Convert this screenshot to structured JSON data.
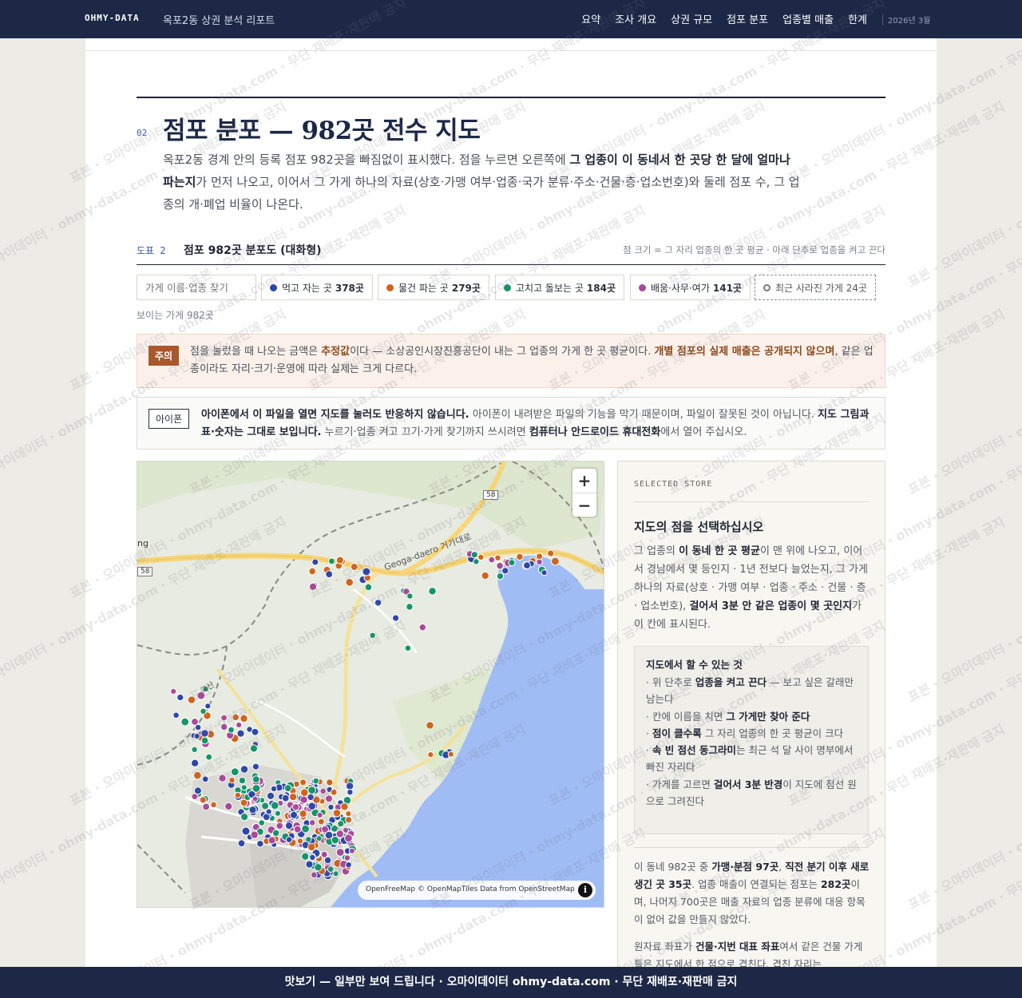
{
  "nav": {
    "brand": "OHMY-DATA",
    "report_title": "옥포2동 상권 분석 리포트",
    "links": [
      "요약",
      "조사 개요",
      "상권 규모",
      "점포 분포",
      "업종별 매출",
      "한계"
    ],
    "date": "2026년 3월"
  },
  "section": {
    "number": "02",
    "title": "점포 분포 — 982곳 전수 지도",
    "lead_1": "옥포2동 경계 안의 등록 점포 982곳을 빠짐없이 표시했다. 점을 누르면 오른쪽에 ",
    "lead_bold": "그 업종이 이 동네서 한 곳당 한 달에 얼마나 파는지",
    "lead_2": "가 먼저 나오고, 이어서 그 가게 하나의 자료(상호·가맹 여부·업종·국가 분류·주소·건물·층·업소번호)와 둘레 점포 수, 그 업종의 개·폐업 비율이 나온다."
  },
  "figure": {
    "label": "도표 2",
    "title": "점포 982곳 분포도 (대화형)",
    "note": "점 크기 = 그 자리 업종의 한 곳 평균 · 아래 단추로 업종을 켜고 끈다",
    "search_placeholder": "가게 이름·업종 찾기",
    "visible_count": "보이는 가게 982곳",
    "filters": [
      {
        "label": "먹고 자는 곳",
        "count": "378곳",
        "color": "#2f47a8"
      },
      {
        "label": "물건 파는 곳",
        "count": "279곳",
        "color": "#d0641d"
      },
      {
        "label": "고치고 돌보는 곳",
        "count": "184곳",
        "color": "#15946a"
      },
      {
        "label": "배움·사무·여가",
        "count": "141곳",
        "color": "#a84a9a"
      }
    ],
    "closed_filter": "최근 사라진 가게 24곳"
  },
  "caution": {
    "tag": "주의",
    "t1": "점을 눌렀을 때 나오는 금액은 ",
    "b1": "추정값",
    "t2": "이다 — 소상공인시장진흥공단이 내는 그 업종의 가게 한 곳 평균이다. ",
    "b2": "개별 점포의 실제 매출은 공개되지 않으며",
    "t3": ", 같은 업종이라도 자리·크기·운영에 따라 실제는 크게 다르다."
  },
  "ios": {
    "tag": "아이폰",
    "b1": "아이폰에서 이 파일을 열면 지도를 눌러도 반응하지 않습니다.",
    "t1": " 아이폰이 내려받은 파일의 기능을 막기 때문이며, 파일이 잘못된 것이 아닙니다. ",
    "b2": "지도 그림과 표·숫자는 그대로 보입니다.",
    "t2": " 누르기·업종 켜고 끄기·가게 찾기까지 쓰시려면 ",
    "b3": "컴퓨터나 안드로이드 휴대전화",
    "t3": "에서 열어 주십시오."
  },
  "map": {
    "zoom_in": "+",
    "zoom_out": "−",
    "attribution": "OpenFreeMap © OpenMapTiles Data from OpenStreetMap",
    "info": "i",
    "road_label": "Geoga-daero 거가대로",
    "route_58": "58",
    "route_58b": "58",
    "edge_label": "ng",
    "peak_label": "국산"
  },
  "panel": {
    "eyebrow": "SELECTED STORE",
    "title": "지도의 점을 선택하십시오",
    "d1": "그 업종의 ",
    "db1": "이 동네 한 곳 평균",
    "d2": "이 맨 위에 나오고, 이어서 경남에서 몇 등인지 · 1년 전보다 늘었는지, 그 가게 하나의 자료(상호 · 가맹 여부 · 업종 · 주소 · 건물 · 층 · 업소번호), ",
    "db2": "걸어서 3분 안 같은 업종이 몇 곳인지",
    "d3": "가 이 칸에 표시된다.",
    "howto_title": "지도에서 할 수 있는 것",
    "h1a": "· 위 단추로 ",
    "h1b": "업종을 켜고 끈다",
    "h1c": " — 보고 싶은 갈래만 남는다",
    "h2a": "· 칸에 이름을 치면 ",
    "h2b": "그 가게만 찾아 준다",
    "h3a": "· ",
    "h3b": "점이 클수록",
    "h3c": " 그 자리 업종의 한 곳 평균이 크다",
    "h4a": "· ",
    "h4b": "속 빈 점선 동그라미",
    "h4c": "는 최근 석 달 사이 명부에서 빠진 자리다",
    "h5a": "· 가게를 고르면 ",
    "h5b": "걸어서 3분 반경",
    "h5c": "이 지도에 점선 원으로 그려진다",
    "s1": "이 동네 982곳 중 ",
    "sb1": "가맹·분점 97곳",
    "s2": ", ",
    "sb2": "직전 분기 이후 새로 생긴 곳 35곳",
    "s3": ". 업종 매출이 연결되는 점포는 ",
    "sb3": "282곳",
    "s4": "이며, 나머지 700곳은 매출 자료의 업종 분류에 대응 항목이 없어 값을 만들지 않았다.",
    "m1": "원자료 좌표가 ",
    "mb1": "건물·지번 대표 좌표",
    "m2": "여서 같은 건물 가게들은 지도에서 한 점으로 겹친다. 겹친 자리는"
  },
  "watermark": "표본 · 오마이데이터 · ohmy-data.com · 무단 재배포·재판매 금지",
  "bottom_banner": "맛보기 — 일부만 보여 드립니다 · 오마이데이터 ohmy-data.com · 무단 재배포·재판매 금지",
  "colors": {
    "navy": "#1c2846",
    "food": "#2f47a8",
    "retail": "#d0641d",
    "service": "#15946a",
    "office": "#a84a9a",
    "sea": "#9fbcf5"
  }
}
